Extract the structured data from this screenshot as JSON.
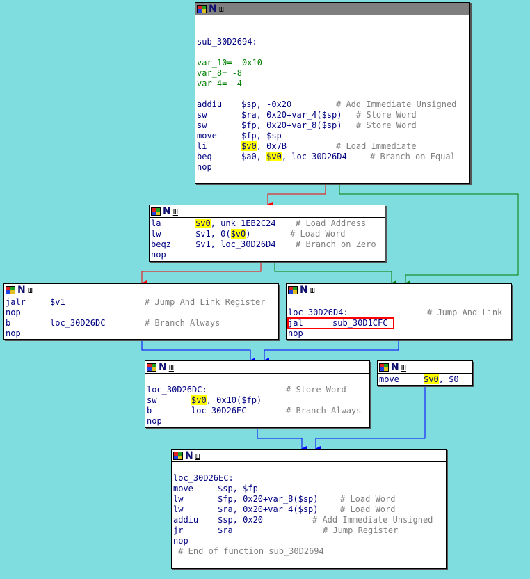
{
  "n1": {
    "label": "sub_30D2694:",
    "vars": [
      {
        "name": "var_10",
        "rest": "= -0x10"
      },
      {
        "name": "var_8",
        "rest": "= -8"
      },
      {
        "name": "var_4",
        "rest": "= -4"
      }
    ],
    "instr": [
      {
        "m": "addiu",
        "o": "$sp, -0x20",
        "c": "# Add Immediate Unsigned"
      },
      {
        "m": "sw",
        "o": "$ra, 0x20+var_4($sp)",
        "c": "# Store Word"
      },
      {
        "m": "sw",
        "o": "$fp, 0x20+var_8($sp)",
        "c": "# Store Word"
      },
      {
        "m": "move",
        "o": "$fp, $sp",
        "c": ""
      },
      {
        "m": "li",
        "o": "$v0, 0x7B",
        "c": "# Load Immediate"
      },
      {
        "m": "beq",
        "o": "$a0, $v0, loc_30D26D4",
        "c": "# Branch on Equal"
      },
      {
        "m": "nop",
        "o": "",
        "c": ""
      }
    ]
  },
  "n2": {
    "instr": [
      {
        "m": "la",
        "o": "$v0, unk_1EB2C24",
        "c": "# Load Address"
      },
      {
        "m": "lw",
        "o": "$v1, 0($v0)",
        "c": "# Load Word"
      },
      {
        "m": "beqz",
        "o": "$v1, loc_30D26D4",
        "c": "# Branch on Zero"
      },
      {
        "m": "nop",
        "o": "",
        "c": ""
      }
    ]
  },
  "n3": {
    "instr": [
      {
        "m": "jalr",
        "o": "$v1",
        "c": "# Jump And Link Register"
      },
      {
        "m": "nop",
        "o": "",
        "c": ""
      },
      {
        "m": "b",
        "o": "loc_30D26DC",
        "c": "# Branch Always"
      },
      {
        "m": "nop",
        "o": "",
        "c": ""
      }
    ]
  },
  "n4": {
    "label": "loc_30D26D4:",
    "label_comment": "# Jump And Link",
    "instr": [
      {
        "m": "jal",
        "o": "sub_30D1CFC",
        "c": ""
      },
      {
        "m": "nop",
        "o": "",
        "c": ""
      }
    ]
  },
  "n5": {
    "label": "loc_30D26DC:",
    "label_comment": "# Store Word",
    "instr": [
      {
        "m": "sw",
        "o": "$v0, 0x10($fp)",
        "c": ""
      },
      {
        "m": "b",
        "o": "loc_30D26EC",
        "c": "# Branch Always"
      },
      {
        "m": "nop",
        "o": "",
        "c": ""
      }
    ]
  },
  "n6": {
    "instr": [
      {
        "m": "move",
        "o": "$v0, $0",
        "c": ""
      }
    ]
  },
  "n7": {
    "label": "loc_30D26EC:",
    "instr": [
      {
        "m": "move",
        "o": "$sp, $fp",
        "c": ""
      },
      {
        "m": "lw",
        "o": "$fp, 0x20+var_8($sp)",
        "c": "# Load Word"
      },
      {
        "m": "lw",
        "o": "$ra, 0x20+var_4($sp)",
        "c": "# Load Word"
      },
      {
        "m": "addiu",
        "o": "$sp, 0x20",
        "c": "# Add Immediate Unsigned"
      },
      {
        "m": "jr",
        "o": "$ra",
        "c": "# Jump Register"
      },
      {
        "m": "nop",
        "o": "",
        "c": ""
      }
    ],
    "footer": " # End of function sub_30D2694"
  },
  "colors": {
    "background": "#7fdcdf",
    "edge_true": "#008000",
    "edge_false": "#ff0000",
    "edge_jump": "#0000ff",
    "highlight": "#ffff00"
  }
}
